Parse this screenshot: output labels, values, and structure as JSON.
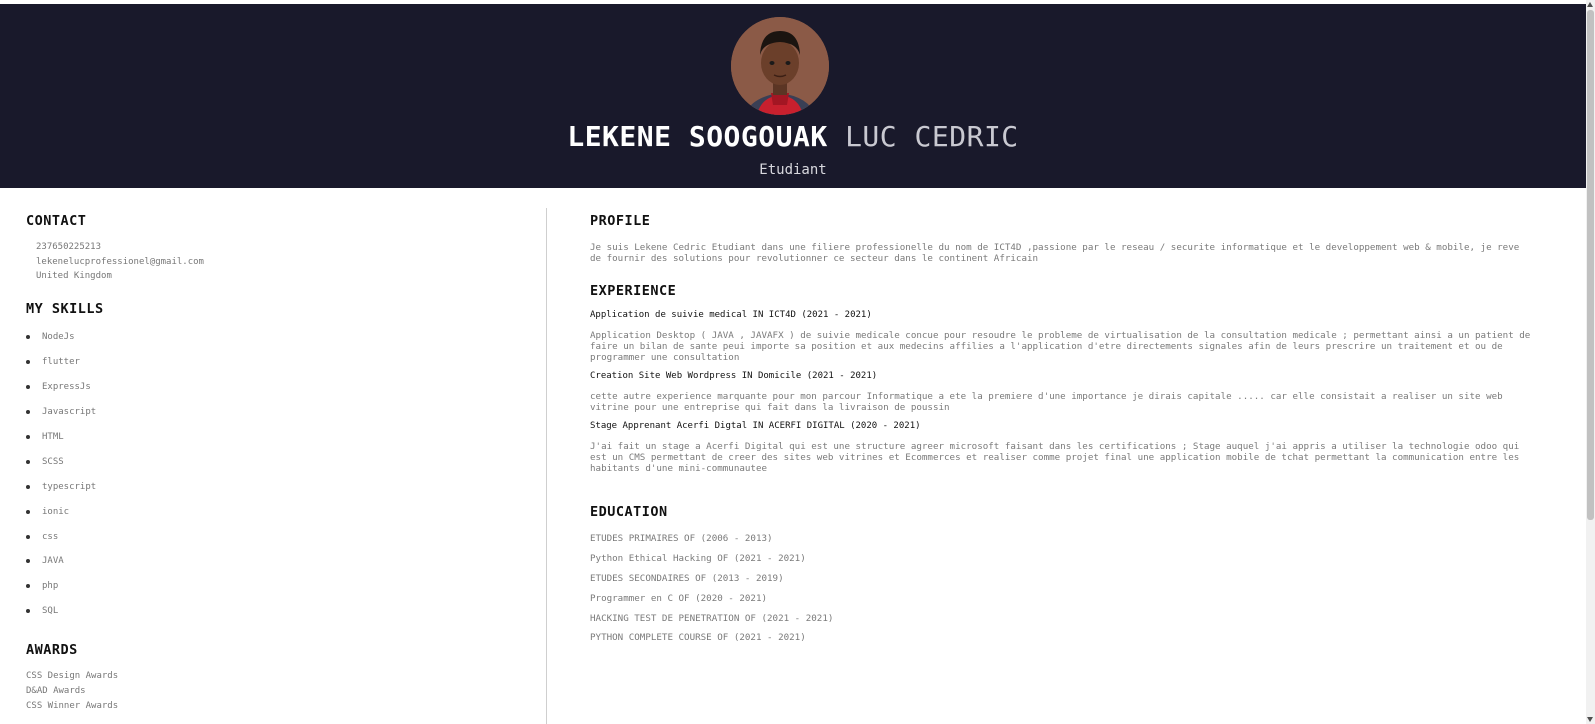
{
  "header": {
    "first_name": "LEKENE SOOGOUAK",
    "last_name": "LUC CEDRIC",
    "job_title": "Etudiant"
  },
  "contact": {
    "heading": "CONTACT",
    "phone": "237650225213",
    "email": "lekenelucprofessionel@gmail.com",
    "location": "United Kingdom"
  },
  "skills": {
    "heading": "MY SKILLS",
    "items": [
      "NodeJs",
      "flutter",
      "ExpressJs",
      "Javascript",
      "HTML",
      "SCSS",
      "typescript",
      "ionic",
      "css",
      "JAVA",
      "php",
      "SQL"
    ]
  },
  "awards": {
    "heading": "AWARDS",
    "items": [
      "CSS Design Awards",
      "D&AD Awards",
      "CSS Winner Awards"
    ]
  },
  "profile": {
    "heading": "PROFILE",
    "text": "Je suis Lekene Cedric Etudiant dans une filiere professionelle du nom de ICT4D ,passione par le reseau / securite informatique et le developpement web & mobile, je reve de fournir des solutions pour revolutionner ce secteur dans le continent Africain"
  },
  "experience": {
    "heading": "EXPERIENCE",
    "items": [
      {
        "title": "Application de suivie medical IN ICT4D (2021 - 2021)",
        "text": "Application Desktop ( JAVA , JAVAFX ) de suivie medicale concue pour resoudre le probleme de virtualisation de la consultation medicale ; permettant ainsi a un patient de faire un bilan de sante peui importe sa position et aux medecins affilies a l'application d'etre directements signales afin de leurs prescrire un traitement et ou de programmer une consultation"
      },
      {
        "title": "Creation Site Web Wordpress IN Domicile (2021 - 2021)",
        "text": "cette autre experience marquante pour mon parcour Informatique a ete la premiere d'une importance je dirais capitale ..... car elle consistait a realiser un site web vitrine pour une entreprise qui fait dans la livraison de poussin"
      },
      {
        "title": "Stage Apprenant Acerfi Digtal IN ACERFI DIGITAL (2020 - 2021)",
        "text": "J'ai fait un stage a Acerfi Digital qui est une structure agreer microsoft faisant dans les certifications ; Stage auquel j'ai appris a utiliser la technologie odoo qui est un CMS permettant de creer des sites web vitrines et Ecommerces et realiser comme projet final une application mobile de tchat permettant la communication entre les habitants d'une mini-communautee"
      }
    ]
  },
  "education": {
    "heading": "EDUCATION",
    "items": [
      "ETUDES PRIMAIRES OF (2006 - 2013)",
      "Python Ethical Hacking OF (2021 - 2021)",
      "ETUDES SECONDAIRES OF (2013 - 2019)",
      "Programmer en C OF (2020 - 2021)",
      "HACKING TEST DE PENETRATION OF (2021 - 2021)",
      "PYTHON COMPLETE COURSE OF (2021 - 2021)"
    ]
  }
}
